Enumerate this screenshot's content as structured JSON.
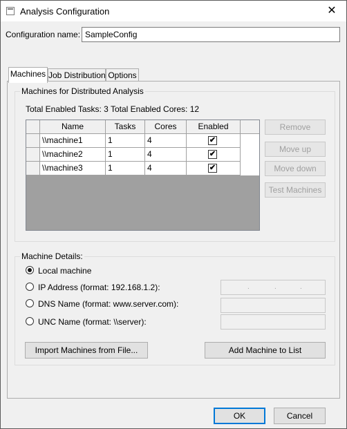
{
  "window": {
    "title": "Analysis Configuration",
    "icon": "window-app-icon",
    "close_glyph": "✕"
  },
  "config": {
    "name_label": "Configuration name:",
    "name_value": "SampleConfig"
  },
  "tabs": [
    {
      "label": "Machines",
      "active": true
    },
    {
      "label": "Job Distribution",
      "active": false
    },
    {
      "label": "Options",
      "active": false
    }
  ],
  "machines_group": {
    "title": "Machines for Distributed Analysis",
    "summary": "Total Enabled Tasks: 3  Total Enabled Cores: 12",
    "columns": [
      "Name",
      "Tasks",
      "Cores",
      "Enabled"
    ],
    "rows": [
      {
        "name": "\\\\machine1",
        "tasks": "1",
        "cores": "4",
        "enabled": true
      },
      {
        "name": "\\\\machine2",
        "tasks": "1",
        "cores": "4",
        "enabled": true
      },
      {
        "name": "\\\\machine3",
        "tasks": "1",
        "cores": "4",
        "enabled": true
      }
    ],
    "check_glyph": "✔",
    "buttons": {
      "remove": "Remove",
      "move_up": "Move up",
      "move_down": "Move down",
      "test": "Test Machines"
    }
  },
  "details_group": {
    "title": "Machine Details:",
    "options": [
      {
        "label": "Local machine",
        "checked": true
      },
      {
        "label": "IP Address (format: 192.168.1.2):",
        "checked": false
      },
      {
        "label": "DNS Name (format: www.server.com):",
        "checked": false
      },
      {
        "label": "UNC Name (format: \\\\server):",
        "checked": false
      }
    ],
    "ip_dots": [
      ".",
      ".",
      "."
    ],
    "import_button": "Import Machines from File...",
    "add_button": "Add Machine to List"
  },
  "footer": {
    "ok": "OK",
    "cancel": "Cancel"
  }
}
